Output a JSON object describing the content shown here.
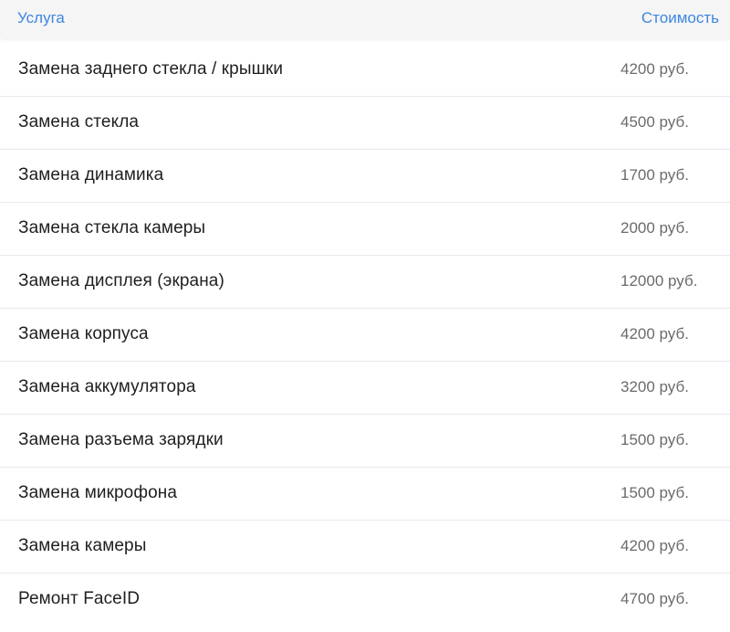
{
  "header": {
    "service_label": "Услуга",
    "price_label": "Стоимость"
  },
  "colors": {
    "accent": "#3d86e0",
    "header_bg": "#f5f5f6",
    "text": "#1f1f1f",
    "price_text": "#6b6b6b",
    "divider": "#e9e9eb"
  },
  "rows": [
    {
      "service": "Замена заднего стекла / крышки",
      "price": "4200 руб."
    },
    {
      "service": "Замена стекла",
      "price": "4500 руб."
    },
    {
      "service": "Замена динамика",
      "price": "1700 руб."
    },
    {
      "service": "Замена стекла камеры",
      "price": "2000 руб."
    },
    {
      "service": "Замена дисплея (экрана)",
      "price": "12000 руб."
    },
    {
      "service": "Замена корпуса",
      "price": "4200 руб."
    },
    {
      "service": "Замена аккумулятора",
      "price": "3200 руб."
    },
    {
      "service": "Замена разъема зарядки",
      "price": "1500 руб."
    },
    {
      "service": "Замена микрофона",
      "price": "1500 руб."
    },
    {
      "service": "Замена камеры",
      "price": "4200 руб."
    },
    {
      "service": "Ремонт FaceID",
      "price": "4700 руб."
    }
  ]
}
